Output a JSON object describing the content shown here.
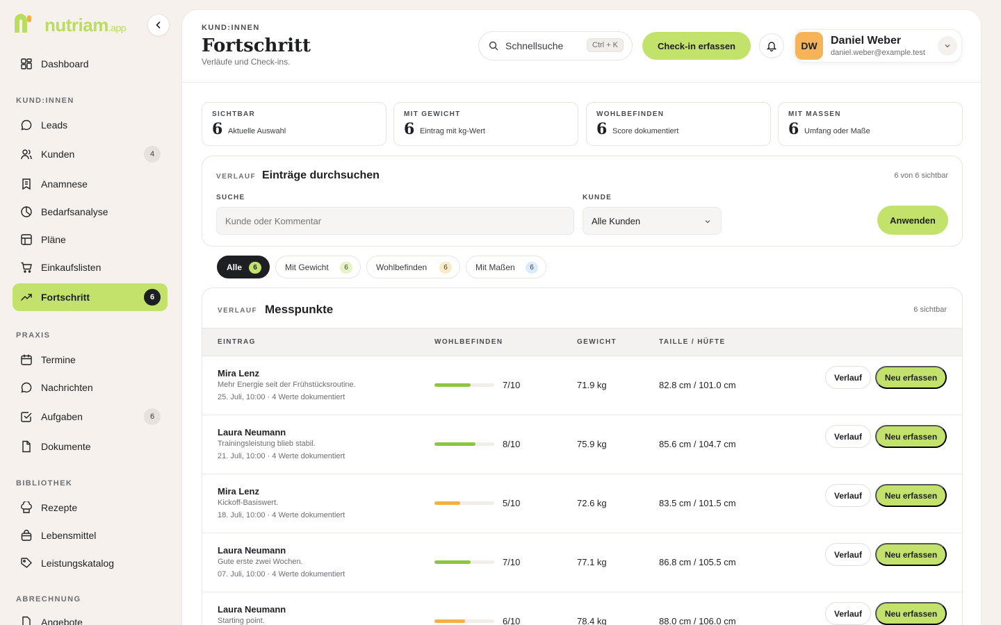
{
  "brand": {
    "name": "nutriam",
    "suffix": ".app",
    "accent": "#c2e26c"
  },
  "sidebar": {
    "dashboard": "Dashboard",
    "sections": {
      "clients": "KUND:INNEN",
      "practice": "PRAXIS",
      "library": "BIBLIOTHEK",
      "billing": "ABRECHNUNG"
    },
    "items": [
      {
        "label": "Leads",
        "icon": "chat-icon"
      },
      {
        "label": "Kunden",
        "icon": "users-icon",
        "badge": "4"
      },
      {
        "label": "Anamnese",
        "icon": "clipboard-icon"
      },
      {
        "label": "Bedarfsanalyse",
        "icon": "clock-icon"
      },
      {
        "label": "Pläne",
        "icon": "table-icon"
      },
      {
        "label": "Einkaufslisten",
        "icon": "cart-icon"
      },
      {
        "label": "Fortschritt",
        "icon": "trend-icon",
        "badge": "6",
        "active": true
      },
      {
        "label": "Termine",
        "icon": "calendar-icon"
      },
      {
        "label": "Nachrichten",
        "icon": "chat-icon"
      },
      {
        "label": "Aufgaben",
        "icon": "checkbox-icon",
        "badge": "6"
      },
      {
        "label": "Dokumente",
        "icon": "document-icon"
      },
      {
        "label": "Rezepte",
        "icon": "chef-hat-icon"
      },
      {
        "label": "Lebensmittel",
        "icon": "bag-icon"
      },
      {
        "label": "Leistungskatalog",
        "icon": "tag-icon"
      },
      {
        "label": "Angebote",
        "icon": "document-icon"
      }
    ]
  },
  "header": {
    "eyebrow": "KUND:INNEN",
    "title": "Fortschritt",
    "subtitle": "Verläufe und Check-ins.",
    "search_label": "Schnellsuche",
    "search_shortcut": "Ctrl + K",
    "checkin_label": "Check-in erfassen",
    "user": {
      "initials": "DW",
      "name": "Daniel Weber",
      "email": "daniel.weber@example.test"
    }
  },
  "stats": [
    {
      "label": "SICHTBAR",
      "value": "6",
      "desc": "Aktuelle Auswahl"
    },
    {
      "label": "MIT GEWICHT",
      "value": "6",
      "desc": "Eintrag mit kg-Wert"
    },
    {
      "label": "WOHLBEFINDEN",
      "value": "6",
      "desc": "Score dokumentiert"
    },
    {
      "label": "MIT MASSEN",
      "value": "6",
      "desc": "Umfang oder Maße"
    }
  ],
  "filter": {
    "eyebrow": "VERLAUF",
    "title": "Einträge durchsuchen",
    "visible_count": "6 von 6 sichtbar",
    "search_label": "SUCHE",
    "search_placeholder": "Kunde oder Kommentar",
    "client_label": "KUNDE",
    "client_value": "Alle Kunden",
    "apply_label": "Anwenden"
  },
  "chips": [
    {
      "label": "Alle",
      "count": "6",
      "color": "#c2e26c"
    },
    {
      "label": "Mit Gewicht",
      "count": "6",
      "color": "#e6f3c4"
    },
    {
      "label": "Wohlbefinden",
      "count": "6",
      "color": "#fdebc8"
    },
    {
      "label": "Mit Maßen",
      "count": "6",
      "color": "#dcebfa"
    }
  ],
  "table": {
    "eyebrow": "VERLAUF",
    "title": "Messpunkte",
    "visible": "6 sichtbar",
    "columns": [
      "EINTRAG",
      "WOHLBEFINDEN",
      "GEWICHT",
      "TAILLE / HÜFTE"
    ],
    "history_label": "Verlauf",
    "new_label": "Neu erfassen",
    "rows": [
      {
        "name": "Mira Lenz",
        "comment": "Mehr Energie seit der Frühstücksroutine.",
        "meta": "25. Juli, 10:00 · 4 Werte dokumentiert",
        "score": 7,
        "score_label": "7/10",
        "weight": "71.9 kg",
        "waist_hip": "82.8 cm / 101.0 cm",
        "bar_color": "#8cc63f"
      },
      {
        "name": "Laura Neumann",
        "comment": "Trainingsleistung blieb stabil.",
        "meta": "21. Juli, 10:00 · 4 Werte dokumentiert",
        "score": 8,
        "score_label": "8/10",
        "weight": "75.9 kg",
        "waist_hip": "85.6 cm / 104.7 cm",
        "bar_color": "#8cc63f"
      },
      {
        "name": "Mira Lenz",
        "comment": "Kickoff-Basiswert.",
        "meta": "18. Juli, 10:00 · 4 Werte dokumentiert",
        "score": 5,
        "score_label": "5/10",
        "weight": "72.6 kg",
        "waist_hip": "83.5 cm / 101.5 cm",
        "bar_color": "#f6b042"
      },
      {
        "name": "Laura Neumann",
        "comment": "Gute erste zwei Wochen.",
        "meta": "07. Juli, 10:00 · 4 Werte dokumentiert",
        "score": 7,
        "score_label": "7/10",
        "weight": "77.1 kg",
        "waist_hip": "86.8 cm / 105.5 cm",
        "bar_color": "#8cc63f"
      },
      {
        "name": "Laura Neumann",
        "comment": "Starting point.",
        "meta": "",
        "score": 6,
        "score_label": "6/10",
        "weight": "78.4 kg",
        "waist_hip": "88.0 cm / 106.0 cm",
        "bar_color": "#f6b042"
      }
    ]
  }
}
